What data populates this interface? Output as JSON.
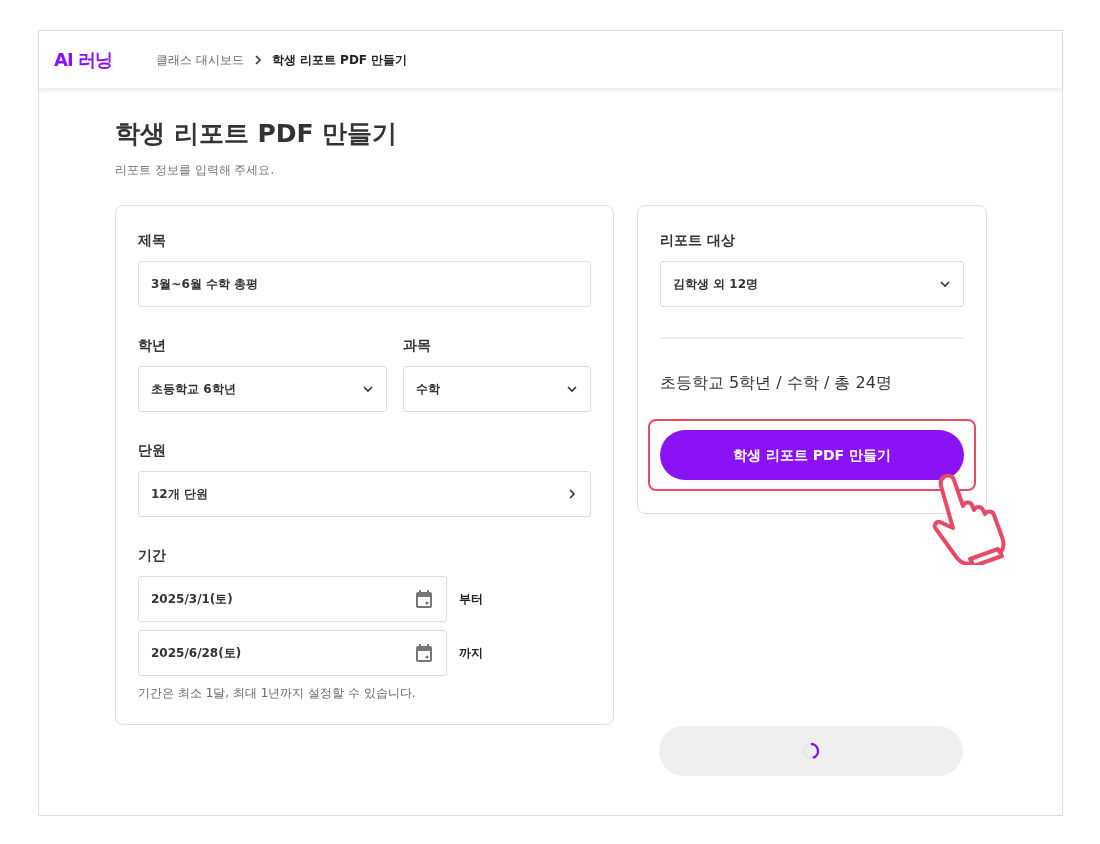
{
  "header": {
    "logo": "AI 러닝",
    "breadcrumb": [
      {
        "label": "클래스 대시보드",
        "current": false
      },
      {
        "label": "학생 리포트 PDF 만들기",
        "current": true
      }
    ]
  },
  "page": {
    "title": "학생 리포트 PDF 만들기",
    "subtitle": "리포트 정보를 입력해 주세요."
  },
  "form": {
    "rows": [
      {
        "fields": [
          {
            "kind": "text",
            "label": "제목",
            "value": "3월~6월 수학 총평"
          }
        ]
      },
      {
        "fields": [
          {
            "kind": "select",
            "label": "학년",
            "value": "초등학교 6학년"
          },
          {
            "kind": "select",
            "label": "과목",
            "value": "수학"
          }
        ]
      },
      {
        "fields": [
          {
            "kind": "link",
            "label": "단원",
            "value": "12개 단원"
          }
        ]
      },
      {
        "fields": [
          {
            "kind": "dates",
            "label": "기간",
            "dates": [
              {
                "value": "2025/3/1(토)",
                "suffix": "부터"
              },
              {
                "value": "2025/6/28(토)",
                "suffix": "까지"
              }
            ],
            "help": "기간은 최소 1달, 최대 1년까지 설정할 수 있습니다."
          }
        ]
      }
    ]
  },
  "report_target": {
    "label": "리포트 대상",
    "value": "김학생 외 12명",
    "summary": "초등학교 5학년 / 수학 / 총 24명",
    "button": {
      "label": "학생 리포트 PDF 만들기",
      "highlighted": true
    }
  },
  "loading_button": {
    "loading": true
  }
}
